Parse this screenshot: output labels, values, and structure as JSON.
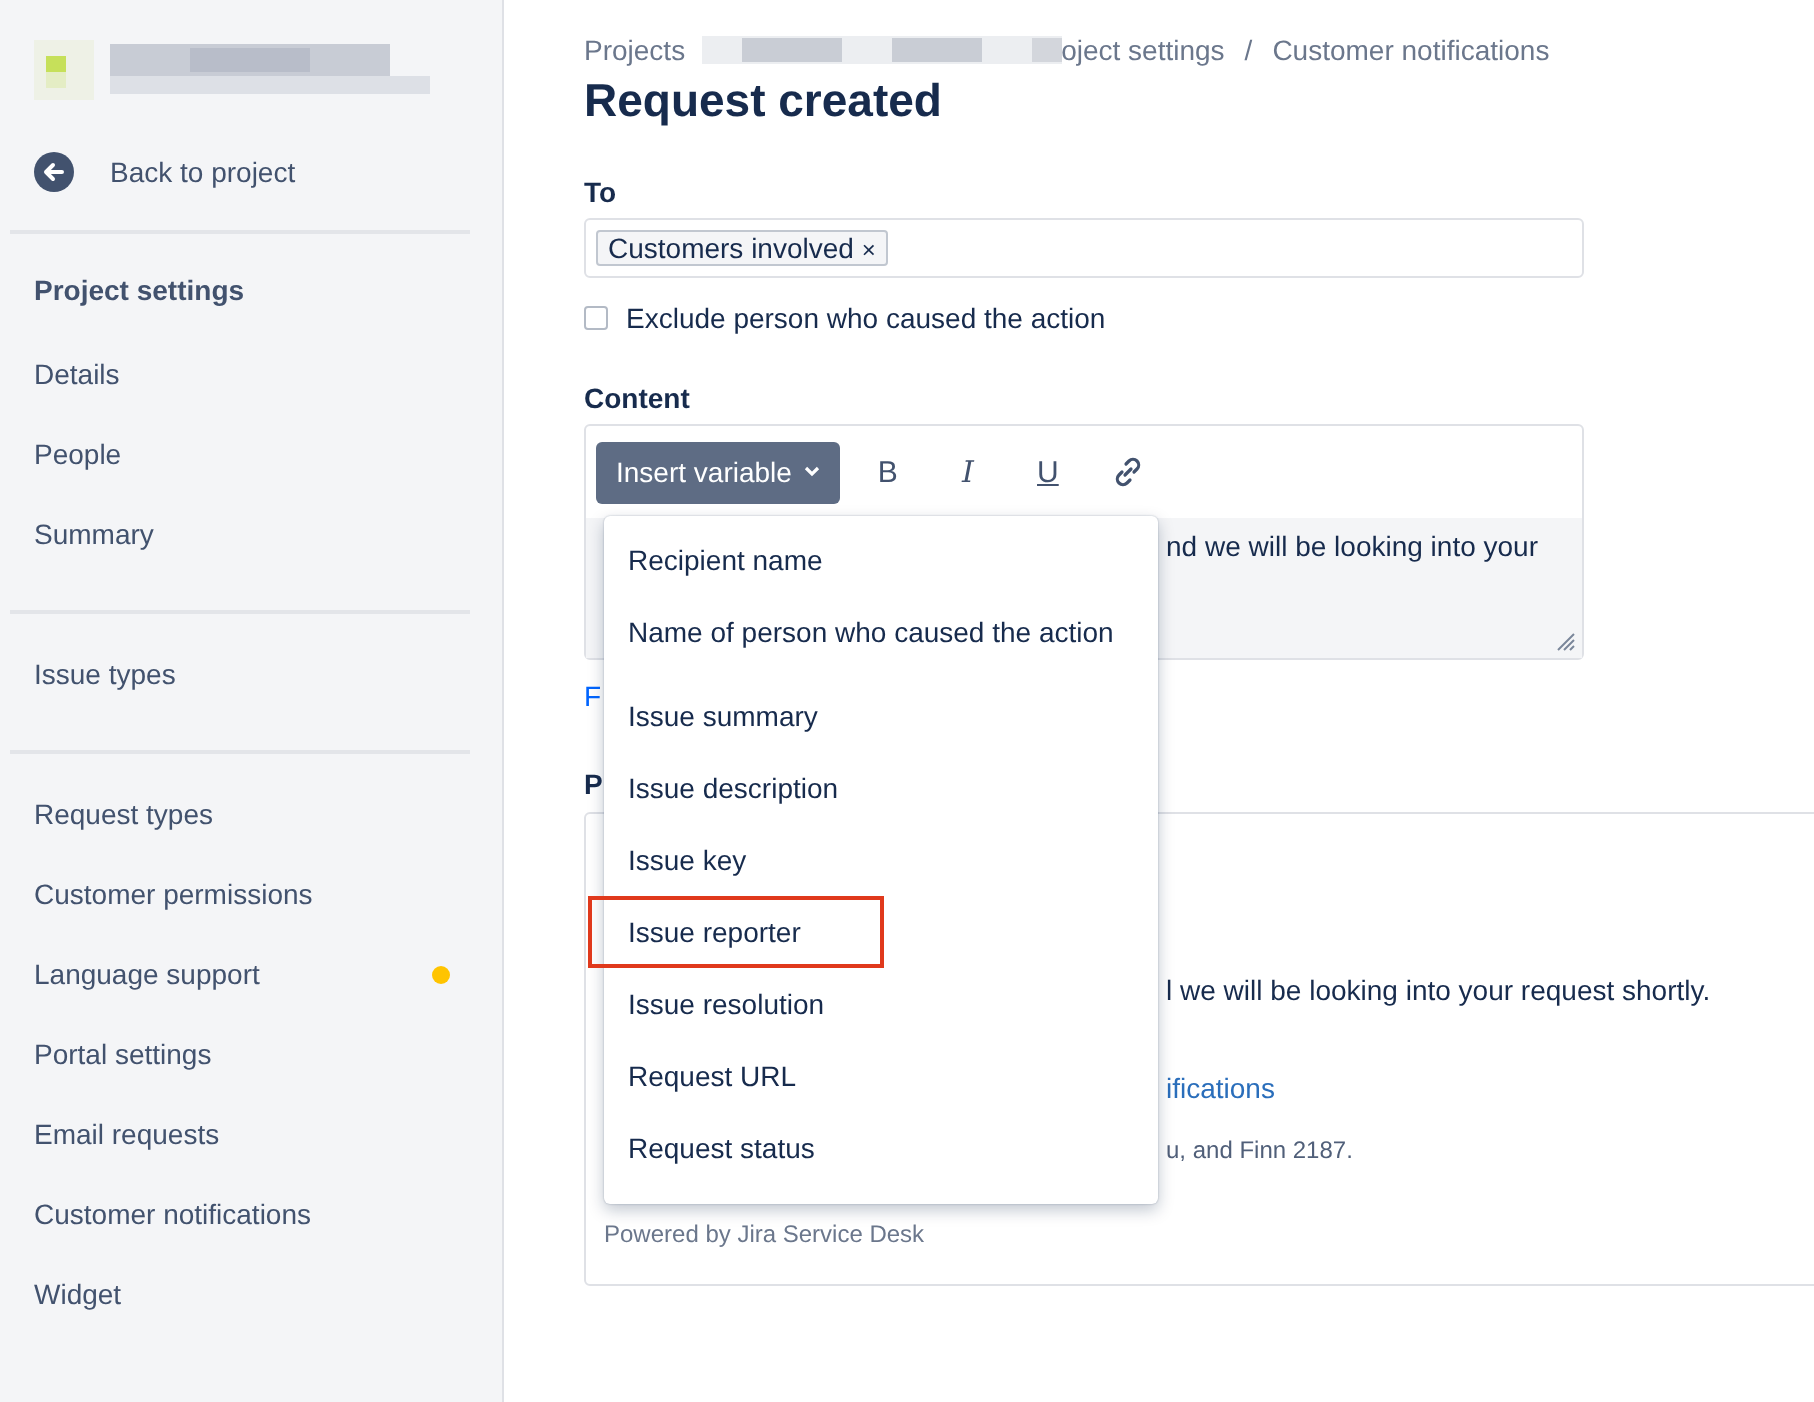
{
  "sidebar": {
    "back_link": "Back to project",
    "sections": [
      {
        "heading": "Project settings",
        "items": [
          {
            "label": "Details",
            "selected": false,
            "attention": false
          },
          {
            "label": "People",
            "selected": false,
            "attention": false
          },
          {
            "label": "Summary",
            "selected": false,
            "attention": false
          }
        ]
      },
      {
        "items": [
          {
            "label": "Issue types",
            "selected": false,
            "attention": false
          }
        ]
      },
      {
        "items": [
          {
            "label": "Request types",
            "selected": false,
            "attention": false
          },
          {
            "label": "Customer permissions",
            "selected": false,
            "attention": false
          },
          {
            "label": "Language support",
            "selected": false,
            "attention": true
          },
          {
            "label": "Portal settings",
            "selected": false,
            "attention": false
          },
          {
            "label": "Email requests",
            "selected": false,
            "attention": false
          },
          {
            "label": "Customer notifications",
            "selected": false,
            "attention": false
          },
          {
            "label": "Widget",
            "selected": false,
            "attention": false
          }
        ]
      }
    ]
  },
  "breadcrumbs": {
    "first": "Projects",
    "partial": "oject settings",
    "separator": "/",
    "last": "Customer notifications"
  },
  "title": "Request created",
  "to": {
    "label": "To",
    "tags": [
      "Customers involved"
    ],
    "remove": "×"
  },
  "exclude": {
    "label": "Exclude person who caused the action",
    "checked": false
  },
  "content": {
    "label": "Content",
    "insert_button": "Insert variable",
    "format_buttons": [
      {
        "kind": "bold",
        "label": "B"
      },
      {
        "kind": "italic",
        "label": "I"
      },
      {
        "kind": "underline",
        "label": "U"
      },
      {
        "kind": "link"
      }
    ],
    "text_fragment": "nd we will be looking into your",
    "below_link_fragment": "F"
  },
  "variable_menu": {
    "groups": [
      [
        {
          "label": "Recipient name",
          "highlighted": false
        },
        {
          "label": "Name of person who caused the action",
          "highlighted": false
        }
      ],
      [
        {
          "label": "Issue summary",
          "highlighted": false
        },
        {
          "label": "Issue description",
          "highlighted": false
        },
        {
          "label": "Issue key",
          "highlighted": false
        },
        {
          "label": "Issue reporter",
          "highlighted": true
        },
        {
          "label": "Issue resolution",
          "highlighted": false
        },
        {
          "label": "Request URL",
          "highlighted": false
        },
        {
          "label": "Request status",
          "highlighted": false
        }
      ]
    ]
  },
  "preview": {
    "label_fragment": "P",
    "body_fragment": "l we will be looking into your request shortly.",
    "link_fragment": "ifications",
    "footer_fragment": "u, and Finn 2187.",
    "powered_by": "Powered by Jira Service Desk"
  }
}
